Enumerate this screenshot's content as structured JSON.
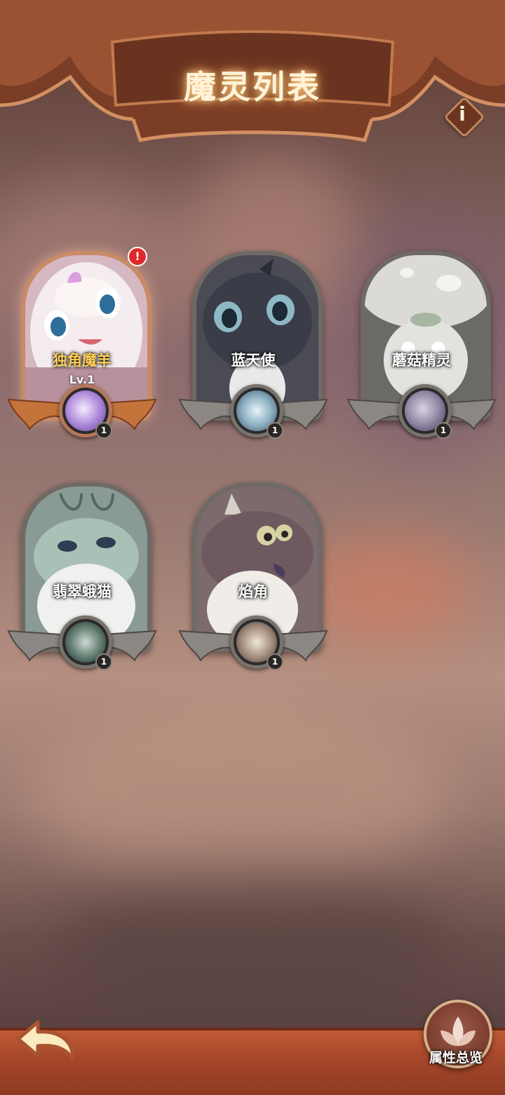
{
  "header": {
    "title": "魔灵列表",
    "info_icon": "i"
  },
  "cards": [
    {
      "name": "独角魔羊",
      "level": "Lv.1",
      "badge": "1",
      "alert": "!",
      "active": true
    },
    {
      "name": "蓝天使",
      "badge": "1"
    },
    {
      "name": "蘑菇精灵",
      "badge": "1"
    },
    {
      "name": "翡翠蛾猫",
      "badge": "1"
    },
    {
      "name": "焰角",
      "badge": "1"
    }
  ],
  "footer": {
    "overview_label": "属性总览"
  },
  "colors": {
    "frame": "#6f6a66",
    "active_frame": "#c98a66",
    "name_active": "#ffcf5a",
    "bar": "#a8482b"
  }
}
